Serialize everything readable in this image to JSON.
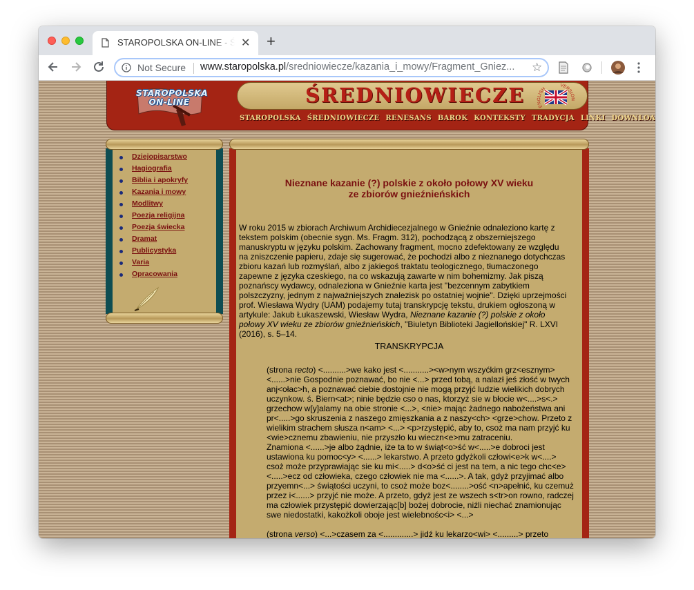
{
  "browser": {
    "tab_title": "STAROPOLSKA ON-LINE - ŚREDNIOWIECZE",
    "new_tab": "+",
    "security_label": "Not Secure",
    "url_host": "www.staropolska.pl",
    "url_path": "/sredniowiecze/kazania_i_mowy/Fragment_Gniez..."
  },
  "header": {
    "logo_line1": "STAROPOLSKA",
    "logo_line2": "ON-LINE",
    "site_title": "ŚREDNIOWIECZE",
    "english_label": "ENGLISH",
    "version_label": "VERSION",
    "nav": [
      "STAROPOLSKA",
      "ŚREDNIOWIECZE",
      "RENESANS",
      "BAROK",
      "KONTEKSTY",
      "TRADYCJA",
      "LINKI",
      "DOWNLOAD"
    ]
  },
  "sidebar": {
    "items": [
      "Dziejopisarstwo",
      "Hagiografia",
      "Biblia i apokryfy",
      "Kazania i mowy",
      "Modlitwy",
      "Poezja religijna",
      "Poezja świecka",
      "Dramat",
      "Publicystyka",
      "Varia",
      "Opracowania"
    ]
  },
  "article": {
    "title_line1": "Nieznane kazanie (?) polskie z około połowy XV wieku",
    "title_line2": "ze zbiorów gnieźnieńskich",
    "intro_part1": "W roku 2015 w zbiorach Archiwum Archidiecezjalnego w Gnieźnie odnaleziono kartę z tekstem polskim (obecnie sygn. Ms. Fragm. 312), pochodzącą z obszerniejszego manuskryptu w języku polskim. Zachowany fragment, mocno zdefektowany ze względu na zniszczenie papieru, zdaje się sugerować, że pochodzi albo z nieznanego dotychczas zbioru kazań lub rozmyślań, albo z jakiegoś traktatu teologicznego, tłumaczonego zapewne z języka czeskiego, na co wskazują zawarte w nim bohemizmy. Jak piszą poznańscy wydawcy, odnaleziona w Gnieźnie karta jest \"bezcennym zabytkiem polszczyzny, jednym z najważniejszych znalezisk po ostatniej wojnie\". Dzięki uprzejmości prof. Wiesława Wydry (UAM) podajemy tutaj transkrypcję tekstu, drukiem ogłoszoną w artykule: Jakub Łukaszewski, Wiesław Wydra, ",
    "intro_italic": "Nieznane kazanie (?) polskie z około połowy XV wieku ze zbiorów gnieźnieńskich",
    "intro_part2": ", \"Biuletyn Biblioteki Jagiellońskiej\" R. LXVI (2016), s. 5–14.",
    "transcription_heading": "TRANSKRYPCJA",
    "p1_prefix": "(strona ",
    "p1_italic": "recto",
    "p1_text": ") <..........>we kako jest <...........><w>nym wszyćkim grz<esznym> <......>nie Gospodnie poznawać, bo nie <...> przed tobą, a nalazł jeś złość w twych anj<ołac>h, a poznawać ciebie dostojnie nie mogą przyjć ludzie wielikich dobrych uczynkow. ś. Biern<at>; ninie będzie cso o nas, ktorzyż sie w błocie w<....>s<.> grzechow w[y]alamy na obie stronie <...>, <nie> mając żadnego nabożeństwa ani pr<.....>go skruszenia z naszego zmięszkania a z naszy<ch> <grze>chow. Przeto z wielikim strachem słusza n<am> <...> <p>rzystępić, aby to, csoż ma nam przyjć ku <wie>cznemu zbawieniu, nie przyszło ku wieczn<e>mu zatraceniu.",
    "p2_text": "Znamiona <......>je albo żądnie, iże ta to w świąt<o>ść w<.....>e dobroci jest ustawiona ku pomoc<y> <......> lekarstwo. A przeto gdyżkoli człowi<e>k w<....> csoż może przypr­awiając sie ku mi<.....> d<o>ść ci jest na tem, a nic tego chc<e> <.....>ecz od człowieka, czego człowiek nie ma <......>. A tak, gdyż przyjimać albo przyemn<...> świątości uczyni, to csoż może boz<........>ość <n>apełnić, ku czemuż przez i<......> przyjć nie może. A przeto, gdyż jest ze wszech s<tr>on rowno, radczej ma człowiek przystępić dowierzając[b] bożej dobrocie, niźli niechać znamionując swe niedostatki, kakożkoli oboje jest wielebnośc<i> <...>",
    "p3_prefix": "(strona ",
    "p3_italic": "verso",
    "p3_text": ") <...>czasem za <.............> jidź ku lekarzo<wi> <.........> przeto"
  }
}
